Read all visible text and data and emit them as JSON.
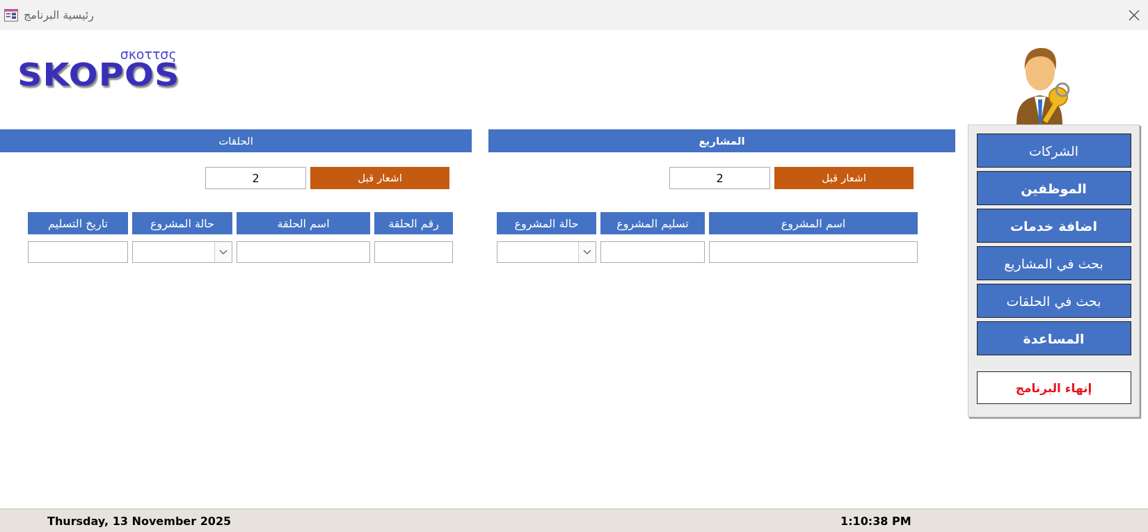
{
  "window": {
    "title": "رئيسية البرنامج"
  },
  "logo": {
    "main": "SKOPOS",
    "sub": "σκοττσς"
  },
  "sections": [
    {
      "title": "المشاريع",
      "bold": true,
      "notify": {
        "label": "اشعار قبل",
        "value": "2"
      },
      "fields": [
        {
          "label": "اسم المشروع",
          "kind": "text"
        },
        {
          "label": "تسليم المشروع",
          "kind": "text"
        },
        {
          "label": "حالة المشروع",
          "kind": "combo"
        }
      ]
    },
    {
      "title": "الحلقات",
      "bold": false,
      "notify": {
        "label": "اشعار قبل",
        "value": "2"
      },
      "fields": [
        {
          "label": "رقم الحلقة",
          "kind": "text"
        },
        {
          "label": "اسم الحلقة",
          "kind": "text"
        },
        {
          "label": "حالة المشروع",
          "kind": "combo"
        },
        {
          "label": "تاريخ التسليم",
          "kind": "text"
        }
      ]
    }
  ],
  "sidebar": {
    "buttons": [
      {
        "label": "الشركات",
        "kind": "nav",
        "bold": false
      },
      {
        "label": "الموظفين",
        "kind": "nav",
        "bold": true
      },
      {
        "label": "اضافة خدمات",
        "kind": "nav",
        "bold": true
      },
      {
        "label": "بحث في المشاريع",
        "kind": "nav",
        "bold": false
      },
      {
        "label": "بحث في الحلقات",
        "kind": "nav",
        "bold": false
      },
      {
        "label": "المساعدة",
        "kind": "nav",
        "bold": true
      },
      {
        "label": "إنهاء البرنامج",
        "kind": "exit",
        "bold": true
      }
    ]
  },
  "status_bar": {
    "date": "Thursday, 13 November 2025",
    "time": "1:10:38 PM"
  }
}
